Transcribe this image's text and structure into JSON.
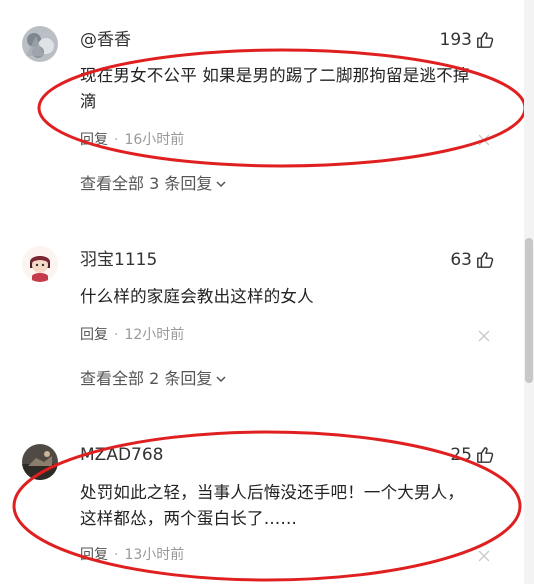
{
  "comments": [
    {
      "username": "@香香",
      "likes": "193",
      "text_line1": "现在男女不公平 如果是男的踢了二脚那拘留是逃不掉",
      "text_line2": "滴",
      "reply_label": "回复",
      "time": "16小时前",
      "view_replies": "查看全部 3 条回复"
    },
    {
      "username": "羽宝1115",
      "likes": "63",
      "text_line1": "什么样的家庭会教出这样的女人",
      "reply_label": "回复",
      "time": "12小时前",
      "view_replies": "查看全部 2 条回复"
    },
    {
      "username": "MZAD768",
      "likes": "25",
      "text_line1": "处罚如此之轻，当事人后悔没还手吧！一个大男人，",
      "text_line2": "这样都怂，两个蛋白长了……",
      "reply_label": "回复",
      "time": "13小时前"
    }
  ],
  "icons": {
    "like": "thumbs-up-icon",
    "close": "close-icon",
    "chevron": "chevron-down-icon"
  },
  "colors": {
    "annotation": "#e02020",
    "text": "#222222",
    "meta": "#999999"
  }
}
